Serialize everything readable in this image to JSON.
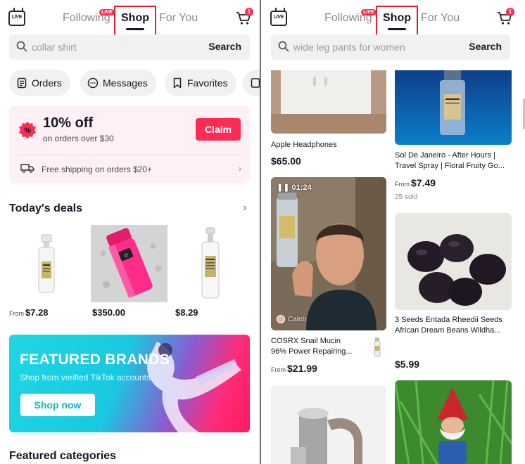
{
  "left": {
    "tabs": [
      "Following",
      "Shop",
      "For You"
    ],
    "live_badge": "LIVE",
    "live_icon_text": "LIVE",
    "cart_count": "1",
    "search": {
      "placeholder": "collar shirt",
      "button": "Search"
    },
    "quick_links": [
      "Orders",
      "Messages",
      "Favorites"
    ],
    "promo": {
      "title": "10% off",
      "subtitle": "on orders over $30",
      "claim": "Claim",
      "shipping": "Free shipping on orders $20+"
    },
    "todays_deals": {
      "title": "Today's deals",
      "items": [
        {
          "from": "From",
          "price": "$7.28"
        },
        {
          "from": "",
          "price": "$350.00"
        },
        {
          "from": "",
          "price": "$8.29"
        }
      ]
    },
    "banner": {
      "title": "FEATURED BRANDS",
      "subtitle": "Shop from verified TikTok accounts",
      "button": "Shop now"
    },
    "featured_categories": "Featured categories"
  },
  "right": {
    "tabs": [
      "Following",
      "Shop",
      "For You"
    ],
    "live_badge": "LIVE",
    "live_icon_text": "LIVE",
    "cart_count": "1",
    "search": {
      "placeholder": "wide leg pants for women",
      "button": "Search"
    },
    "products": [
      {
        "title": "Apple Headphones",
        "price": "$65.00",
        "from": ""
      },
      {
        "title": "Sol De Janeiro - After Hours |",
        "title2": "Travel Spray | Floral Fruity Go...",
        "from": "From",
        "price": "$7.49",
        "sold": "25 sold"
      },
      {
        "title": "COSRX Snail Mucin",
        "title2": "96% Power Repairing...",
        "from": "From",
        "price": "$21.99",
        "video_time": "01:24",
        "creator": "Caleb"
      },
      {
        "title": "3 Seeds Entada Rheedii Seeds",
        "title2": "African Dream Beans Wildha...",
        "from": "",
        "price": "$5.99"
      }
    ]
  },
  "colors": {
    "accent": "#fe2c55",
    "highlight_box": "#e0202a",
    "banner_cyan": "#1fd6e3"
  }
}
